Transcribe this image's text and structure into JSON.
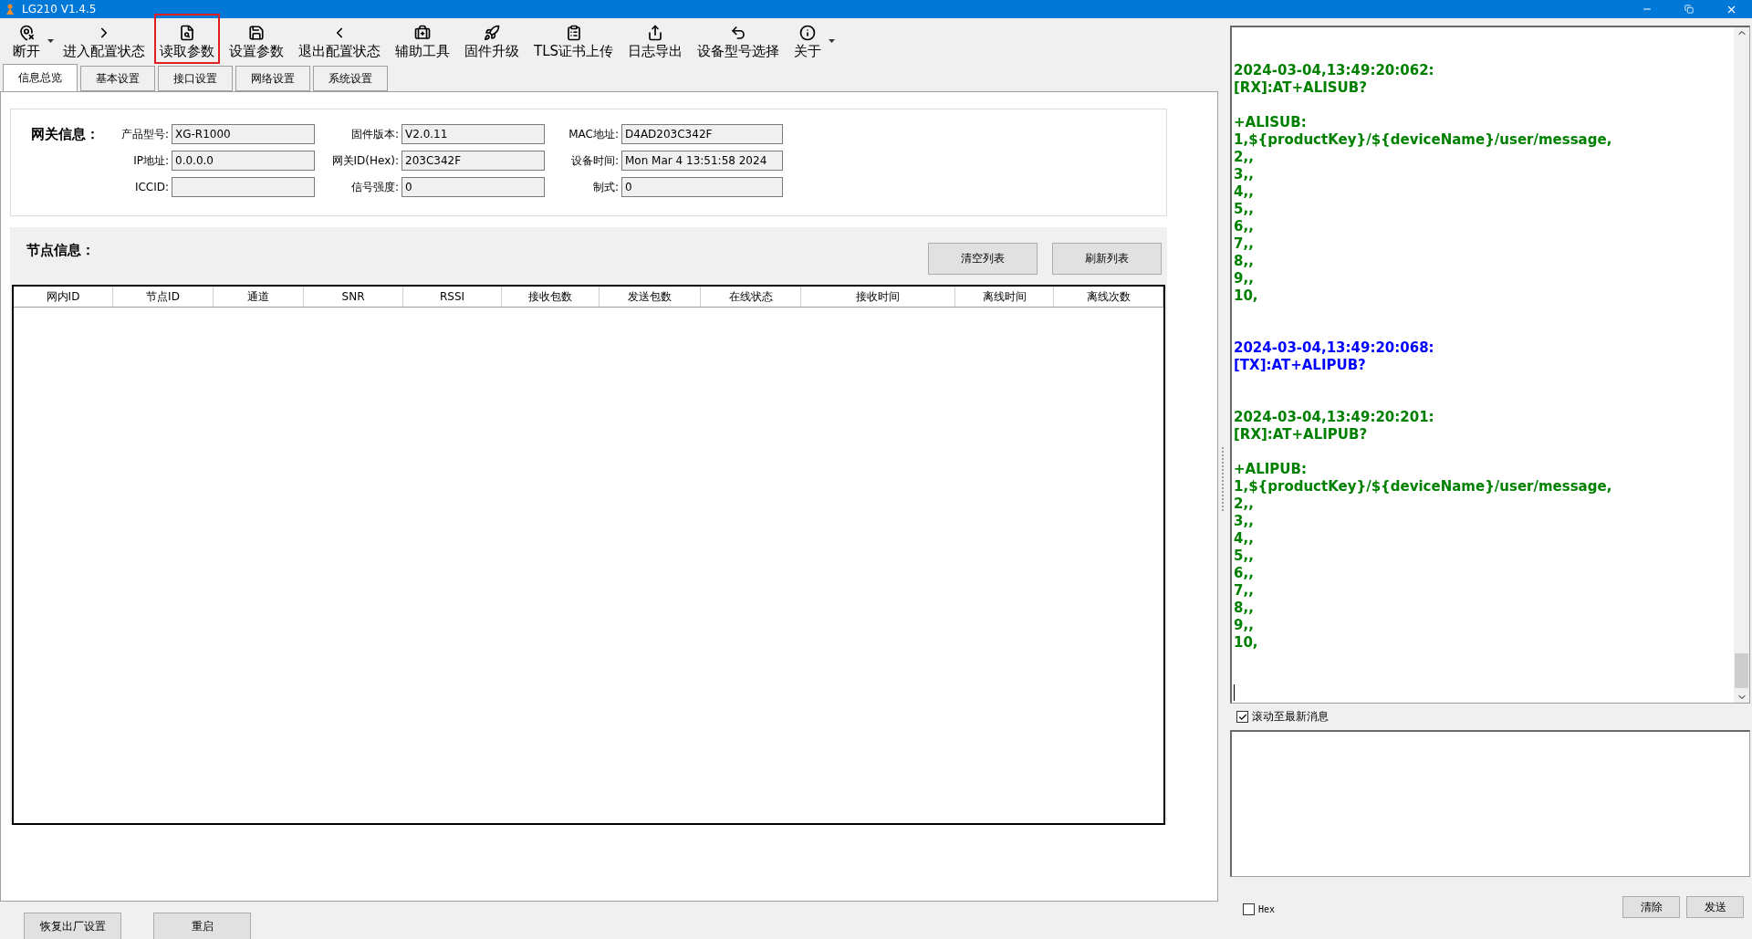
{
  "window": {
    "title": "LG210 V1.4.5"
  },
  "toolbar": {
    "items": [
      {
        "label": "断开",
        "selected": false,
        "has_dropdown": true
      },
      {
        "label": "进入配置状态",
        "selected": false,
        "has_dropdown": false
      },
      {
        "label": "读取参数",
        "selected": true,
        "has_dropdown": false
      },
      {
        "label": "设置参数",
        "selected": false,
        "has_dropdown": false
      },
      {
        "label": "退出配置状态",
        "selected": false,
        "has_dropdown": false
      },
      {
        "label": "辅助工具",
        "selected": false,
        "has_dropdown": false
      },
      {
        "label": "固件升级",
        "selected": false,
        "has_dropdown": false
      },
      {
        "label": "TLS证书上传",
        "selected": false,
        "has_dropdown": false
      },
      {
        "label": "日志导出",
        "selected": false,
        "has_dropdown": false
      },
      {
        "label": "设备型号选择",
        "selected": false,
        "has_dropdown": false
      },
      {
        "label": "关于",
        "selected": false,
        "has_dropdown": true
      }
    ]
  },
  "tabs": [
    {
      "label": "信息总览",
      "selected": true
    },
    {
      "label": "基本设置",
      "selected": false
    },
    {
      "label": "接口设置",
      "selected": false
    },
    {
      "label": "网络设置",
      "selected": false
    },
    {
      "label": "系统设置",
      "selected": false
    }
  ],
  "gateway": {
    "title": "网关信息：",
    "fields": [
      {
        "label": "产品型号:",
        "value": "XG-R1000"
      },
      {
        "label": "固件版本:",
        "value": "V2.0.11"
      },
      {
        "label": "MAC地址:",
        "value": "D4AD203C342F"
      },
      {
        "label": "IP地址:",
        "value": "0.0.0.0"
      },
      {
        "label": "网关ID(Hex):",
        "value": "203C342F"
      },
      {
        "label": "设备时间:",
        "value": "Mon Mar  4 13:51:58 2024"
      },
      {
        "label": "ICCID:"
      },
      {
        "label": "信号强度:",
        "value": "0"
      },
      {
        "label": "制式:",
        "value": "0"
      }
    ]
  },
  "nodes": {
    "title": "节点信息：",
    "buttons": [
      "清空列表",
      "刷新列表"
    ],
    "columns": [
      "网内ID",
      "节点ID",
      "通道",
      "SNR",
      "RSSI",
      "接收包数",
      "发送包数",
      "在线状态",
      "接收时间",
      "离线时间",
      "离线次数"
    ]
  },
  "log": {
    "entries": [
      {
        "kind": "header",
        "color": "#008000",
        "lines": [
          "2024-03-04,13:49:20:062:",
          "[RX]:AT+ALISUB?"
        ]
      },
      {
        "kind": "body",
        "color": "#008000",
        "lines": [
          "+ALISUB:",
          "1,${productKey}/${deviceName}/user/message,",
          "2,,",
          "3,,",
          "4,,",
          "5,,",
          "6,,",
          "7,,",
          "8,,",
          "9,,",
          "10,"
        ]
      },
      {
        "kind": "header",
        "color": "#0000ff",
        "lines": [
          "2024-03-04,13:49:20:068:",
          "[TX]:AT+ALIPUB?"
        ]
      },
      {
        "kind": "header",
        "color": "#008000",
        "lines": [
          "2024-03-04,13:49:20:201:",
          "[RX]:AT+ALIPUB?"
        ]
      },
      {
        "kind": "body",
        "color": "#008000",
        "lines": [
          "+ALIPUB:",
          "1,${productKey}/${deviceName}/user/message,",
          "2,,",
          "3,,",
          "4,,",
          "5,,",
          "6,,",
          "7,,",
          "8,,",
          "9,,",
          "10,"
        ]
      }
    ]
  },
  "auto_scroll": {
    "label": "滚动至最新消息",
    "checked": true
  },
  "hex": {
    "label": "Hex",
    "checked": false
  },
  "send_buttons": [
    "清除",
    "发送"
  ],
  "bottom_buttons": [
    "恢复出厂设置",
    "重启"
  ]
}
